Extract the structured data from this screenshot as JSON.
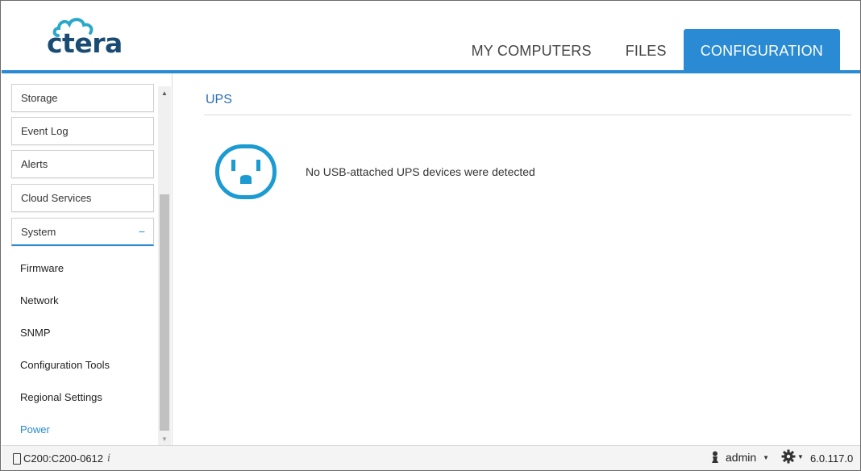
{
  "brand": {
    "logo_text": "ctera",
    "logo_color": "#1a4b73",
    "cloud_color": "#2aa8c9"
  },
  "nav": {
    "tabs": [
      {
        "label": "MY COMPUTERS",
        "active": false
      },
      {
        "label": "FILES",
        "active": false
      },
      {
        "label": "CONFIGURATION",
        "active": true
      }
    ]
  },
  "sidebar": {
    "buttons": [
      {
        "label": "Storage"
      },
      {
        "label": "Event Log"
      },
      {
        "label": "Alerts"
      },
      {
        "label": "Cloud Services"
      },
      {
        "label": "System",
        "expanded": true,
        "toggle": "−"
      }
    ],
    "sub_items": [
      {
        "label": "Firmware"
      },
      {
        "label": "Network"
      },
      {
        "label": "SNMP"
      },
      {
        "label": "Configuration Tools"
      },
      {
        "label": "Regional Settings"
      },
      {
        "label": "Power",
        "active": true
      }
    ]
  },
  "main": {
    "title": "UPS",
    "message": "No USB-attached UPS devices were detected",
    "icon": "power-outlet-icon"
  },
  "statusbar": {
    "device": "C200:C200-0612",
    "info_icon": "i",
    "user": "admin",
    "version": "6.0.117.0"
  },
  "colors": {
    "accent": "#2a8ad4",
    "icon": "#1b9bd1",
    "title": "#2a6fb0"
  }
}
